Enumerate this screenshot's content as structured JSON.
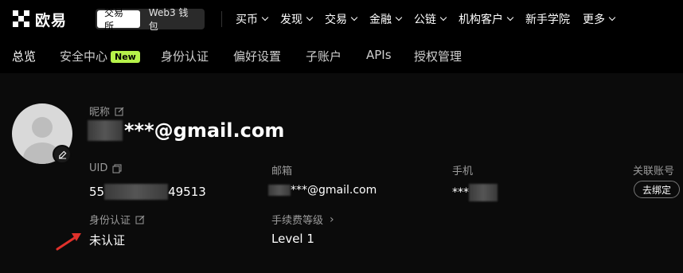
{
  "brand": {
    "name": "欧易"
  },
  "mode_switch": {
    "exchange": "交易所",
    "wallet": "Web3 钱包"
  },
  "menu": [
    "买币",
    "发现",
    "交易",
    "金融",
    "公链",
    "机构客户",
    "新手学院",
    "更多"
  ],
  "menu_has_dropdown": [
    true,
    true,
    true,
    true,
    true,
    true,
    false,
    true
  ],
  "tabs": {
    "overview": "总览",
    "security": "安全中心",
    "security_badge": "New",
    "identity": "身份认证",
    "preferences": "偏好设置",
    "subaccount": "子账户",
    "apis": "APIs",
    "authorization": "授权管理"
  },
  "profile": {
    "nickname_label": "昵称",
    "nickname_value": "***@gmail.com",
    "uid_label": "UID",
    "uid_prefix": "55",
    "uid_suffix": "49513",
    "email_label": "邮箱",
    "email_value": "***@gmail.com",
    "phone_label": "手机",
    "phone_value": "***",
    "linked_label": "关联账号",
    "unbind_button": "去绑定",
    "kyc_label": "身份认证",
    "kyc_value": "未认证",
    "fee_label": "手续费等级",
    "fee_value": "Level 1"
  },
  "colors": {
    "accent_green": "#b6f24a",
    "arrow_red": "#e0312b"
  }
}
